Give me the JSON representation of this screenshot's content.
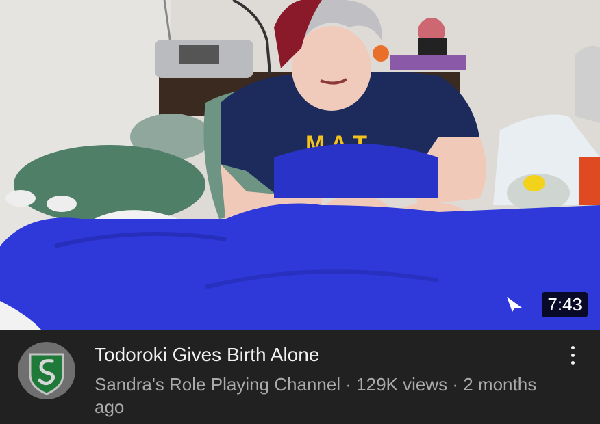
{
  "video": {
    "duration": "7:43",
    "title": "Todoroki Gives Birth Alone",
    "channel": "Sandra's Role Playing Channel",
    "views": "129K views",
    "age": "2 months ago",
    "meta_line": "Sandra's Role Playing Channel · 129K views · 2 months ago"
  },
  "icons": {
    "thumbnail_overlay": "cast-pointer-icon",
    "more": "more-vertical-icon",
    "avatar": "slytherin-crest-icon"
  },
  "colors": {
    "background": "#212121",
    "title_text": "#f1f1f1",
    "meta_text": "#aaaaaa",
    "blanket": "#2f38d9",
    "avatar_green": "#1f7a3a"
  }
}
